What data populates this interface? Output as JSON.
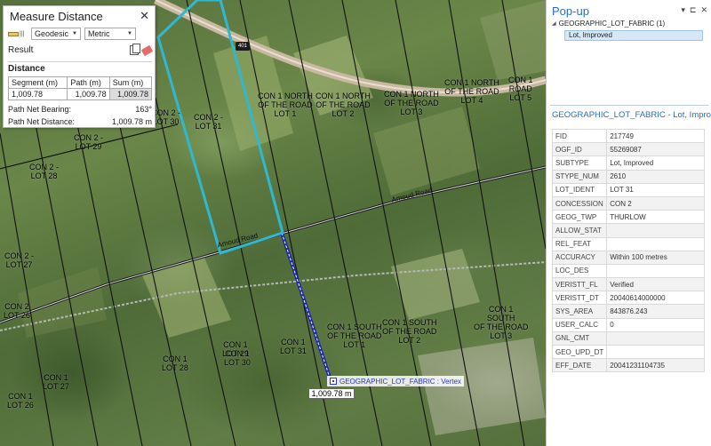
{
  "map": {
    "highway_shield": "401",
    "road_label": "Amoud Road",
    "lot_labels": [
      "CON 2 -\nLOT 29",
      "CON 2 -\nLOT 28",
      "CON 2 -\nLOT 27",
      "CON 2\nLOT 26",
      "CON 1\nLOT 28",
      "CON 1\nLOT 27",
      "CON 1\nLOT 26",
      "CON 2 -\nLOT 31",
      "CON 1 NORTH\nOF THE ROAD\nLOT 1",
      "CON 1 NORTH\nOF THE ROAD\nLOT 2",
      "CON 1 NORTH\nOF THE ROAD\nLOT 3",
      "CON 1 NORTH\nOF THE ROAD\nLOT 4",
      "CON 1\nLOT 29",
      "CON 1\nLOT 30",
      "CON 1\nLOT 31",
      "CON 1 SOUTH\nOF THE ROAD\nLOT 1",
      "CON 1 SOUTH\nOF THE ROAD\nLOT 2",
      "CON 1\nSOUTH\nOF THE ROAD\nLOT 3",
      "CON 1\nROAD\nLOT 5",
      "CON 2 -\nLOT 30"
    ],
    "vertex_tip": "GEOGRAPHIC_LOT_FABRIC : Vertex",
    "distance_tip": "1,009.78 m"
  },
  "measure": {
    "title": "Measure Distance",
    "close": "✕",
    "ruler_glyph": "|||",
    "mode": "Geodesic",
    "units": "Metric",
    "result_label": "Result",
    "distance_label": "Distance",
    "columns": [
      "Segment (m)",
      "Path (m)",
      "Sum (m)"
    ],
    "row": [
      "1,009.78",
      "1,009.78",
      "1,009.78"
    ],
    "net_bearing_label": "Path Net Bearing:",
    "net_bearing_value": "163°",
    "net_distance_label": "Path Net Distance:",
    "net_distance_value": "1,009.78 m"
  },
  "popup": {
    "title": "Pop-up",
    "controls": [
      "▾",
      "⊏",
      "✕"
    ],
    "layer": "GEOGRAPHIC_LOT_FABRIC  (1)",
    "feature": "Lot, Improved",
    "feature_title": "GEOGRAPHIC_LOT_FABRIC - Lot, Improved",
    "fields": [
      [
        "FID",
        "217749"
      ],
      [
        "OGF_ID",
        "55269087"
      ],
      [
        "SUBTYPE",
        "Lot, Improved"
      ],
      [
        "STYPE_NUM",
        "2610"
      ],
      [
        "LOT_IDENT",
        "LOT 31"
      ],
      [
        "CONCESSION",
        "CON 2"
      ],
      [
        "GEOG_TWP",
        "THURLOW"
      ],
      [
        "ALLOW_STAT",
        ""
      ],
      [
        "REL_FEAT",
        ""
      ],
      [
        "ACCURACY",
        "Within 100 metres"
      ],
      [
        "LOC_DES",
        ""
      ],
      [
        "VERISTT_FL",
        "Verified"
      ],
      [
        "VERISTT_DT",
        "20040614000000"
      ],
      [
        "SYS_AREA",
        "843876.243"
      ],
      [
        "USER_CALC",
        "0"
      ],
      [
        "GNL_CMT",
        ""
      ],
      [
        "GEO_UPD_DT",
        ""
      ],
      [
        "EFF_DATE",
        "20041231104735"
      ]
    ]
  },
  "colors": {
    "selection_cyan": "#2fb8d2",
    "highlight_blue": "#1f8fd6",
    "popup_accent": "#2a6ebb"
  }
}
